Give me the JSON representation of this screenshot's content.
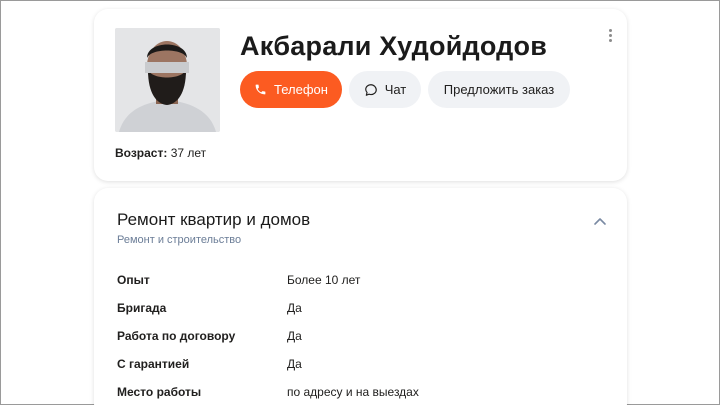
{
  "profile": {
    "name": "Акбарали Худойдодов",
    "buttons": {
      "phone": "Телефон",
      "chat": "Чат",
      "offer": "Предложить заказ"
    },
    "age_label": "Возраст:",
    "age_value": " 37 лет"
  },
  "service": {
    "title": "Ремонт квартир и домов",
    "category": "Ремонт и строительство",
    "details": [
      {
        "label": "Опыт",
        "value": "Более 10 лет"
      },
      {
        "label": "Бригада",
        "value": "Да"
      },
      {
        "label": "Работа по договору",
        "value": "Да"
      },
      {
        "label": "С гарантией",
        "value": "Да"
      },
      {
        "label": "Место работы",
        "value": "по адресу и на выездах"
      }
    ]
  },
  "colors": {
    "accent": "#fc5b21",
    "category_text": "#6b7d97",
    "secondary_button": "#f0f2f5"
  },
  "icons": [
    "phone-icon",
    "chat-icon",
    "more-vertical-icon",
    "chevron-up-icon"
  ]
}
